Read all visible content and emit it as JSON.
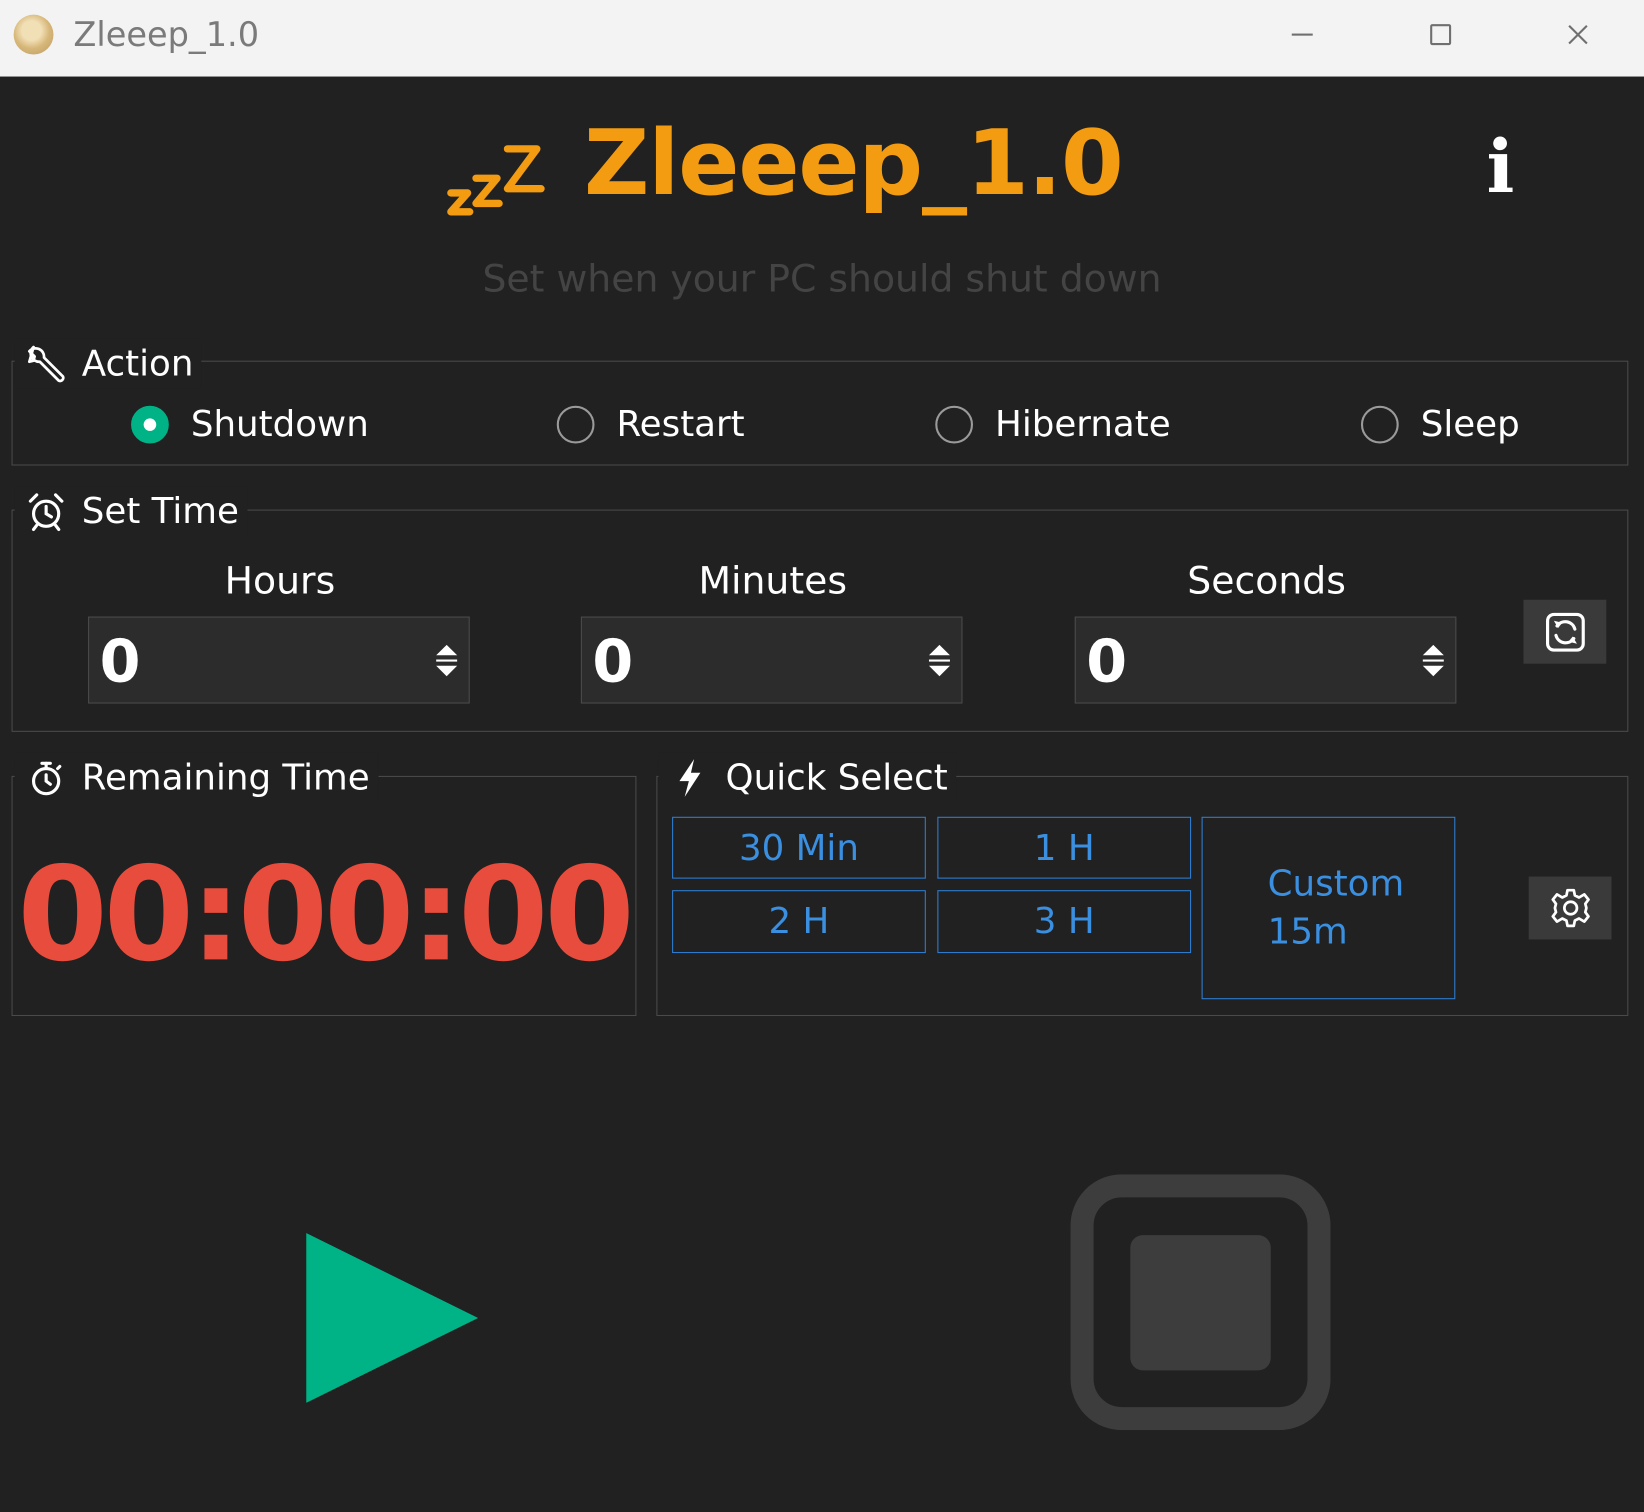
{
  "window": {
    "title": "Zleeep_1.0",
    "controls": [
      "minimize",
      "maximize",
      "close"
    ]
  },
  "header": {
    "title": "Zleeep_1.0",
    "subtitle": "Set when your PC should shut down",
    "logo_icon": "zzz-icon",
    "info_icon": "i"
  },
  "colors": {
    "accent_orange": "#f39c12",
    "timer_red": "#e74c3c",
    "play_green": "#00b386",
    "quick_blue": "#2f7fd4",
    "background": "#212121"
  },
  "action": {
    "label": "Action",
    "icon": "wrench-icon",
    "options": [
      {
        "label": "Shutdown",
        "checked": true
      },
      {
        "label": "Restart",
        "checked": false
      },
      {
        "label": "Hibernate",
        "checked": false
      },
      {
        "label": "Sleep",
        "checked": false
      }
    ]
  },
  "set_time": {
    "label": "Set Time",
    "icon": "alarm-clock-icon",
    "hours": {
      "label": "Hours",
      "value": "0"
    },
    "minutes": {
      "label": "Minutes",
      "value": "0"
    },
    "seconds": {
      "label": "Seconds",
      "value": "0"
    },
    "reset_icon": "refresh-icon"
  },
  "remaining": {
    "label": "Remaining Time",
    "icon": "stopwatch-icon",
    "value": "00:00:00"
  },
  "quick_select": {
    "label": "Quick Select",
    "icon": "lightning-icon",
    "buttons": [
      "30 Min",
      "1 H",
      "2 H",
      "3 H"
    ],
    "custom": {
      "line1": "Custom",
      "line2": "15m"
    },
    "settings_icon": "gear-icon"
  },
  "controls": {
    "start_icon": "play-icon",
    "stop_icon": "stop-icon"
  }
}
